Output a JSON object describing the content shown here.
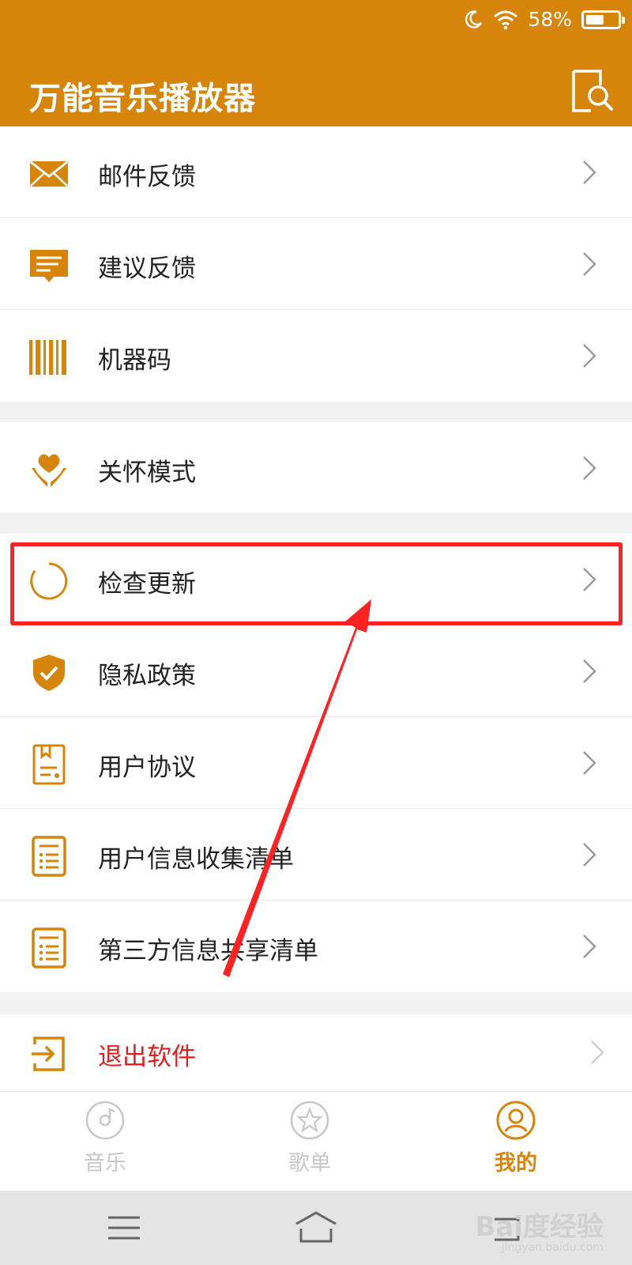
{
  "status": {
    "battery_text": "58%",
    "battery_level": 0.58
  },
  "appbar": {
    "title": "万能音乐播放器"
  },
  "groups": [
    {
      "items": [
        {
          "label": "邮件反馈",
          "icon": "mail-icon"
        },
        {
          "label": "建议反馈",
          "icon": "message-icon"
        },
        {
          "label": "机器码",
          "icon": "barcode-icon"
        }
      ]
    },
    {
      "items": [
        {
          "label": "关怀模式",
          "icon": "care-hands-icon"
        }
      ]
    },
    {
      "items": [
        {
          "label": "检查更新",
          "icon": "update-circle-icon"
        },
        {
          "label": "隐私政策",
          "icon": "shield-check-icon"
        },
        {
          "label": "用户协议",
          "icon": "agreement-doc-icon"
        },
        {
          "label": "用户信息收集清单",
          "icon": "list-doc-icon"
        },
        {
          "label": "第三方信息共享清单",
          "icon": "list-doc-icon"
        }
      ]
    },
    {
      "items": [
        {
          "label": "退出软件",
          "icon": "exit-icon",
          "color": "#e02020"
        }
      ]
    }
  ],
  "tabs": [
    {
      "label": "音乐",
      "icon": "music-disc-icon",
      "active": false
    },
    {
      "label": "歌单",
      "icon": "star-icon",
      "active": false
    },
    {
      "label": "我的",
      "icon": "user-icon",
      "active": true
    }
  ],
  "colors": {
    "accent": "#d6850a",
    "annotation": "#ff2222",
    "danger": "#e02020"
  },
  "watermark": {
    "text": "Bai度经验",
    "sub": "jingyan.baidu.com"
  }
}
